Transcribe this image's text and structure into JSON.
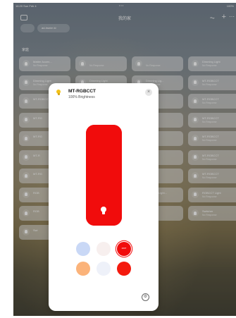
{
  "status_bar": {
    "time": "16:20",
    "date": "Sun Feb 4",
    "battery": "100%"
  },
  "nav": {
    "title": "我的家"
  },
  "pill_label": "ad-hsnim ki",
  "section_title": "家庭",
  "tiles": [
    {
      "name": "Matter Accen...",
      "status": "No Response"
    },
    {
      "name": "",
      "status": "No Response"
    },
    {
      "name": "",
      "status": "No Response"
    },
    {
      "name": "Dimming Light",
      "status": "No Response"
    },
    {
      "name": "Dimming Light",
      "status": "No Response"
    },
    {
      "name": "Dimming Light",
      "status": "No Response"
    },
    {
      "name": "Dimming Lig...",
      "status": "No Response"
    },
    {
      "name": "MT-RGBCCT",
      "status": "No Response"
    },
    {
      "name": "MT-RGBCCT",
      "status": ""
    },
    {
      "name": "",
      "status": ""
    },
    {
      "name": "RGBCCT",
      "status": ""
    },
    {
      "name": "MT-RGBCCT",
      "status": "No Response"
    },
    {
      "name": "MT-RG",
      "status": ""
    },
    {
      "name": "",
      "status": ""
    },
    {
      "name": "RGBCCT",
      "status": ""
    },
    {
      "name": "MT-RGBCCT",
      "status": "No Response"
    },
    {
      "name": "MT-RG",
      "status": ""
    },
    {
      "name": "",
      "status": ""
    },
    {
      "name": "RGBCCT",
      "status": ""
    },
    {
      "name": "MT-RGBCCT",
      "status": "No Response"
    },
    {
      "name": "MT-R",
      "status": ""
    },
    {
      "name": "",
      "status": ""
    },
    {
      "name": "RGBCCT",
      "status": ""
    },
    {
      "name": "MT-RGBCCT",
      "status": "No Response"
    },
    {
      "name": "MT-RG",
      "status": ""
    },
    {
      "name": "",
      "status": ""
    },
    {
      "name": "RGBCCT",
      "status": ""
    },
    {
      "name": "MT-RGBCCT",
      "status": "No Response"
    },
    {
      "name": "RGB",
      "status": ""
    },
    {
      "name": "",
      "status": ""
    },
    {
      "name": "RGBCCT Light...",
      "status": ""
    },
    {
      "name": "RGBCCT Light",
      "status": "No Response"
    },
    {
      "name": "RGB",
      "status": ""
    },
    {
      "name": "",
      "status": ""
    },
    {
      "name": "Switcher",
      "status": ""
    },
    {
      "name": "Switcher",
      "status": "No Response"
    },
    {
      "name": "Swi",
      "status": ""
    }
  ],
  "card": {
    "name": "MT-RGBCCT",
    "status": "100% Brightness",
    "close_glyph": "×",
    "brightness": 100,
    "slider_color": "#f10c0c",
    "swatches": [
      {
        "color": "#c9d8f6",
        "selected": false,
        "label": ""
      },
      {
        "color": "#f7efee",
        "selected": false,
        "label": ""
      },
      {
        "color": "#f10c0c",
        "selected": true,
        "label": "2007"
      },
      {
        "color": "#fbb37a",
        "selected": false,
        "label": ""
      },
      {
        "color": "#eef1f9",
        "selected": false,
        "label": ""
      },
      {
        "color": "#f41a0e",
        "selected": false,
        "label": ""
      }
    ],
    "settings_glyph": "⚙"
  },
  "colors": {
    "card_bg": "#ffffff",
    "accent_red": "#f10c0c",
    "bulb_yellow": "#f3c21a"
  }
}
